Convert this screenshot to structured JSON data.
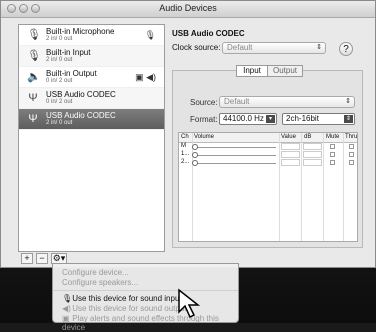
{
  "window": {
    "title": "Audio Devices"
  },
  "devices": [
    {
      "name": "Built-in Microphone",
      "sub": "2 in/ 0 out",
      "icon": "microphone-icon",
      "right": "🎙"
    },
    {
      "name": "Built-in Input",
      "sub": "2 in/ 0 out",
      "icon": "microphone-icon",
      "right": ""
    },
    {
      "name": "Built-in Output",
      "sub": "0 in/ 2 out",
      "icon": "speaker-icon",
      "right": "▣ ◀)"
    },
    {
      "name": "USB Audio CODEC",
      "sub": "0 in/ 2 out",
      "icon": "usb-icon",
      "right": ""
    },
    {
      "name": "USB Audio CODEC",
      "sub": "2 in/ 0 out",
      "icon": "usb-icon",
      "right": ""
    }
  ],
  "list_buttons": {
    "add": "+",
    "remove": "−",
    "gear": "⚙▾"
  },
  "panel": {
    "device_name": "USB Audio CODEC",
    "clock_label": "Clock source:",
    "clock_value": "Default",
    "help": "?",
    "tabs": {
      "input": "Input",
      "output": "Output"
    },
    "source_label": "Source:",
    "source_value": "Default",
    "format_label": "Format:",
    "format_rate": "44100.0 Hz",
    "format_bits": "2ch-16bit"
  },
  "grid": {
    "headers": {
      "ch": "Ch",
      "volume": "Volume",
      "value": "Value",
      "db": "dB",
      "mute": "Mute",
      "thru": "Thru"
    },
    "rows": [
      {
        "ch": "M"
      },
      {
        "ch": "1..."
      },
      {
        "ch": "2..."
      }
    ]
  },
  "menu": {
    "configure_device": "Configure device...",
    "configure_speakers": "Configure speakers...",
    "use_input": "Use this device for sound input",
    "use_output": "Use this device for sound output",
    "play_alerts": "Play alerts and sound effects through this device"
  }
}
